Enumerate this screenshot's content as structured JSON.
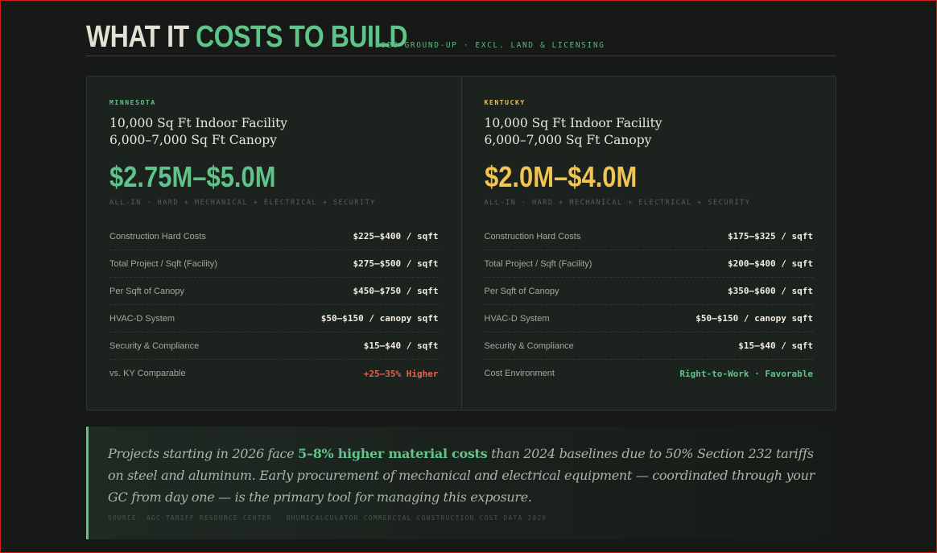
{
  "header": {
    "title_part1": "WHAT IT ",
    "title_part2": "COSTS TO BUILD",
    "subtitle": "2026 GROUND-UP · EXCL. LAND & LICENSING"
  },
  "cards": [
    {
      "state": "MINNESOTA",
      "facility_line1": "10,000 Sq Ft Indoor Facility",
      "facility_line2": "6,000–7,000 Sq Ft Canopy",
      "range": "$2.75M–$5.0M",
      "note": "ALL-IN · HARD + MECHANICAL + ELECTRICAL + SECURITY",
      "rows": [
        {
          "label": "Construction Hard Costs",
          "value": "$225–$400 / sqft"
        },
        {
          "label": "Total Project / Sqft (Facility)",
          "value": "$275–$500 / sqft"
        },
        {
          "label": "Per Sqft of Canopy",
          "value": "$450–$750 / sqft"
        },
        {
          "label": "HVAC-D System",
          "value": "$50–$150 / canopy sqft"
        },
        {
          "label": "Security & Compliance",
          "value": "$15–$40 / sqft"
        },
        {
          "label": "vs. KY Comparable",
          "value": "+25–35% Higher"
        }
      ]
    },
    {
      "state": "KENTUCKY",
      "facility_line1": "10,000 Sq Ft Indoor Facility",
      "facility_line2": "6,000–7,000 Sq Ft Canopy",
      "range": "$2.0M–$4.0M",
      "note": "ALL-IN · HARD + MECHANICAL + ELECTRICAL + SECURITY",
      "rows": [
        {
          "label": "Construction Hard Costs",
          "value": "$175–$325 / sqft"
        },
        {
          "label": "Total Project / Sqft (Facility)",
          "value": "$200–$400 / sqft"
        },
        {
          "label": "Per Sqft of Canopy",
          "value": "$350–$600 / sqft"
        },
        {
          "label": "HVAC-D System",
          "value": "$50–$150 / canopy sqft"
        },
        {
          "label": "Security & Compliance",
          "value": "$15–$40 / sqft"
        },
        {
          "label": "Cost Environment",
          "value": "Right-to-Work · Favorable"
        }
      ]
    }
  ],
  "quote": {
    "before": "Projects starting in 2026 face ",
    "highlight": "5–8% higher material costs",
    "after": " than 2024 baselines due to 50% Section 232 tariffs on steel and aluminum. Early procurement of mechanical and electrical equipment — coordinated through your GC from day one — is the primary tool for managing this exposure.",
    "source": "SOURCE: AGC TARIFF RESOURCE CENTER · BHUMICALCULATOR COMMERCIAL CONSTRUCTION COST DATA 2026"
  },
  "colors": {
    "accent_green": "#5fc48a",
    "accent_gold": "#f2c451",
    "alert_red": "#e8614f",
    "background": "#161916"
  }
}
